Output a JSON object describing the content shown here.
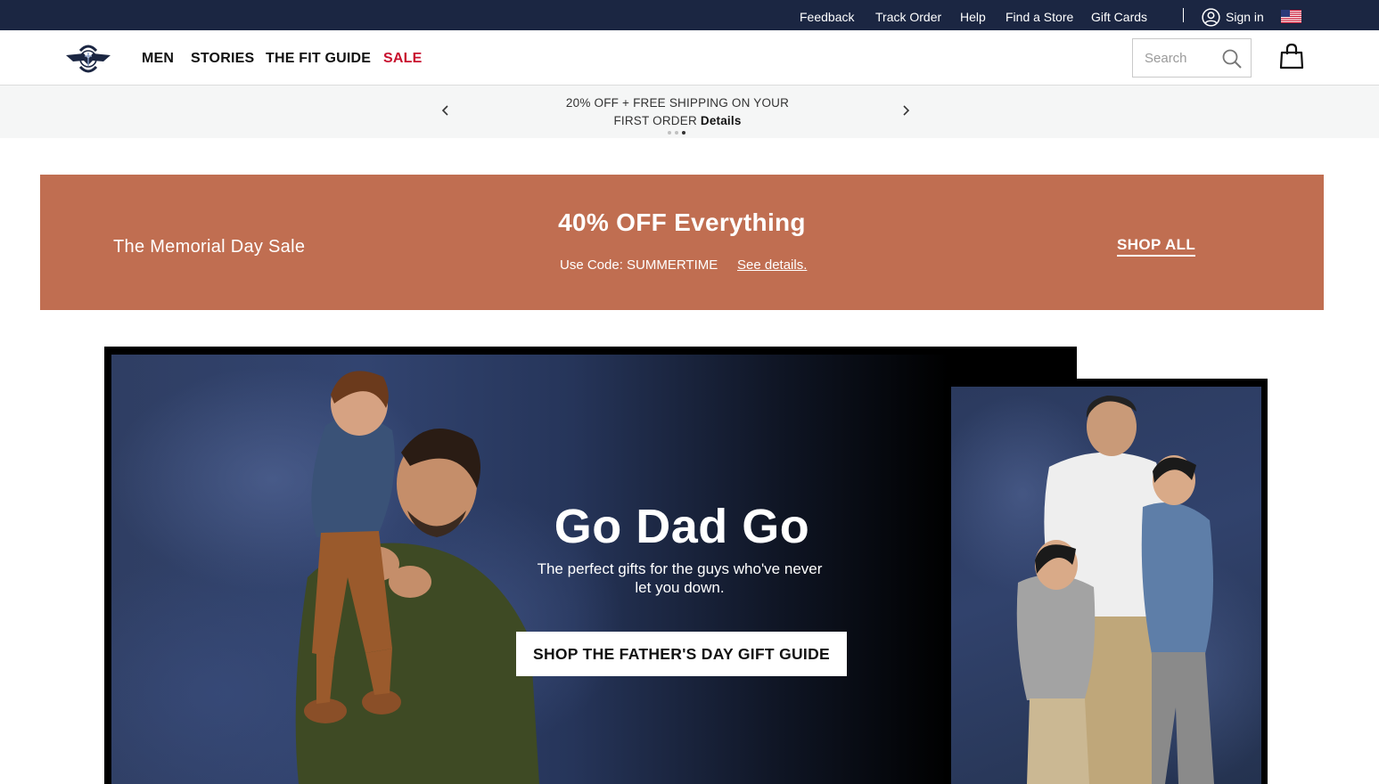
{
  "utility_bar": {
    "links": [
      "Feedback",
      "Track Order",
      "Help",
      "Find a Store",
      "Gift Cards"
    ],
    "sign_in": "Sign in",
    "region_icon": "us-flag-icon"
  },
  "header": {
    "logo_alt": "DOCKERS",
    "nav": [
      {
        "label": "MEN"
      },
      {
        "label": "STORIES"
      },
      {
        "label": "THE FIT GUIDE"
      },
      {
        "label": "SALE"
      }
    ],
    "search_placeholder": "Search",
    "icons": [
      "search-icon",
      "shopping-bag-icon"
    ]
  },
  "promo": {
    "line1": "20% OFF + FREE SHIPPING ON YOUR",
    "line2": "FIRST ORDER",
    "details_label": "Details",
    "slide_count": 3,
    "active_slide": 3
  },
  "sale_banner": {
    "name": "The Memorial Day Sale",
    "headline": "40% OFF Everything",
    "code_text": "Use Code: SUMMERTIME",
    "details_label": "See details.",
    "cta_label": "SHOP ALL",
    "background_color": "#c06e51"
  },
  "hero": {
    "title": "Go Dad Go",
    "subtitle": "The perfect gifts for the guys who've never let you down.",
    "cta_label": "SHOP THE FATHER'S DAY GIFT GUIDE"
  },
  "colors": {
    "utility_bar": "#1b2642",
    "sale_nav": "#c8102e",
    "promo_strip": "#f5f6f6"
  }
}
